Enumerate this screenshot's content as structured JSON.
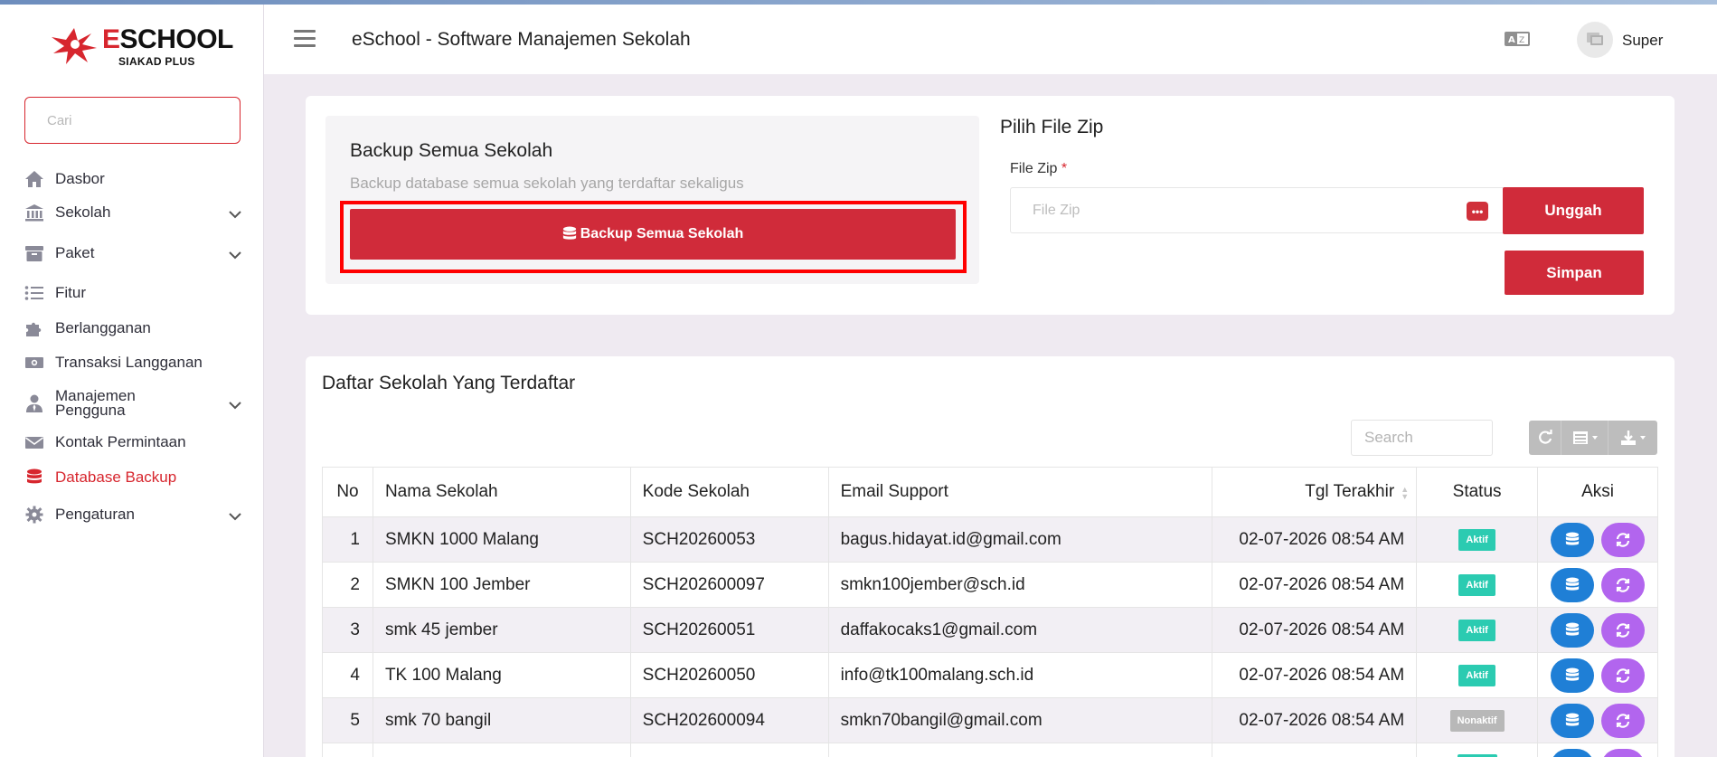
{
  "brand": {
    "name_e": "E",
    "name_rest": "SCHOOL",
    "tagline": "SIAKAD PLUS"
  },
  "sidebar": {
    "search_placeholder": "Cari",
    "items": [
      {
        "label": "Dasbor",
        "icon": "home-icon"
      },
      {
        "label": "Sekolah",
        "icon": "bank-icon",
        "expandable": true
      },
      {
        "label": "Paket",
        "icon": "archive-icon",
        "expandable": true
      },
      {
        "label": "Fitur",
        "icon": "list-icon"
      },
      {
        "label": "Berlangganan",
        "icon": "puzzle-icon"
      },
      {
        "label": "Transaksi Langganan",
        "icon": "money-icon"
      },
      {
        "label": "Manajemen Pengguna",
        "label_line1": "Manajemen",
        "label_line2": "Pengguna",
        "icon": "user-tie-icon",
        "expandable": true
      },
      {
        "label": "Kontak Permintaan",
        "icon": "envelope-icon"
      },
      {
        "label": "Database Backup",
        "icon": "database-icon",
        "active": true
      },
      {
        "label": "Pengaturan",
        "icon": "gear-icon",
        "expandable": true
      }
    ]
  },
  "header": {
    "title": "eSchool - Software Manajemen Sekolah",
    "user_name": "Super"
  },
  "backup": {
    "title": "Backup Semua Sekolah",
    "subtitle": "Backup database semua sekolah yang terdaftar sekaligus",
    "button_label": "Backup Semua Sekolah"
  },
  "zip": {
    "title": "Pilih File Zip",
    "label": "File Zip",
    "required_mark": "*",
    "placeholder": "File Zip",
    "dots": "•••",
    "upload_label": "Unggah",
    "save_label": "Simpan"
  },
  "schools": {
    "title": "Daftar Sekolah Yang Terdaftar",
    "search_placeholder": "Search",
    "columns": [
      "No",
      "Nama Sekolah",
      "Kode Sekolah",
      "Email Support",
      "Tgl Terakhir",
      "Status",
      "Aksi"
    ],
    "rows": [
      {
        "no": "1",
        "name": "SMKN 1000 Malang",
        "code": "SCH20260053",
        "email": "bagus.hidayat.id@gmail.com",
        "date": "02-07-2026 08:54 AM",
        "status": "Aktif"
      },
      {
        "no": "2",
        "name": "SMKN 100 Jember",
        "code": "SCH202600097",
        "email": "smkn100jember@sch.id",
        "date": "02-07-2026 08:54 AM",
        "status": "Aktif"
      },
      {
        "no": "3",
        "name": "smk 45 jember",
        "code": "SCH20260051",
        "email": "daffakocaks1@gmail.com",
        "date": "02-07-2026 08:54 AM",
        "status": "Aktif"
      },
      {
        "no": "4",
        "name": "TK 100 Malang",
        "code": "SCH20260050",
        "email": "info@tk100malang.sch.id",
        "date": "02-07-2026 08:54 AM",
        "status": "Aktif"
      },
      {
        "no": "5",
        "name": "smk 70 bangil",
        "code": "SCH202600094",
        "email": "smkn70bangil@gmail.com",
        "date": "02-07-2026 08:54 AM",
        "status": "Nonaktif"
      }
    ]
  },
  "colors": {
    "accent": "#d02b3a",
    "active_badge": "#2bcbb1",
    "inactive_badge": "#b8b8b8",
    "action_blue": "#1f7fd6",
    "action_purple": "#b265ee"
  }
}
